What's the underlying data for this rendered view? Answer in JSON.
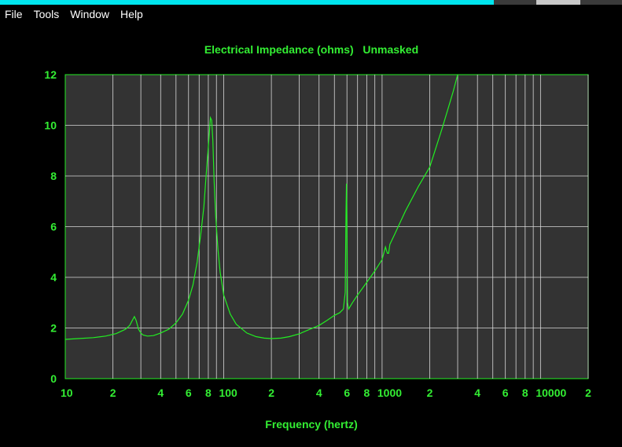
{
  "menu": {
    "items": [
      "File",
      "Tools",
      "Window",
      "Help"
    ]
  },
  "colors": {
    "background": "#000000",
    "plot_background": "#333333",
    "grid": "#d8d8d8",
    "curve": "#22ee22",
    "text": "#33ee33",
    "titlebar": "#00e5ee"
  },
  "chart_data": {
    "type": "line",
    "title": "Electrical Impedance (ohms)   Unmasked",
    "xlabel": "Frequency (hertz)",
    "ylabel": "",
    "xscale": "log",
    "xlim": [
      10,
      20000
    ],
    "ylim": [
      0,
      12
    ],
    "grid": true,
    "yticks": [
      "0",
      "2",
      "4",
      "6",
      "8",
      "10",
      "12"
    ],
    "xticks": [
      {
        "value": 10,
        "label": "10"
      },
      {
        "value": 20,
        "label": "2"
      },
      {
        "value": 40,
        "label": "4"
      },
      {
        "value": 60,
        "label": "6"
      },
      {
        "value": 80,
        "label": "8"
      },
      {
        "value": 100,
        "label": "100"
      },
      {
        "value": 200,
        "label": "2"
      },
      {
        "value": 400,
        "label": "4"
      },
      {
        "value": 600,
        "label": "6"
      },
      {
        "value": 800,
        "label": "8"
      },
      {
        "value": 1000,
        "label": "1000"
      },
      {
        "value": 2000,
        "label": "2"
      },
      {
        "value": 4000,
        "label": "4"
      },
      {
        "value": 6000,
        "label": "6"
      },
      {
        "value": 8000,
        "label": "8"
      },
      {
        "value": 10000,
        "label": "10000"
      },
      {
        "value": 20000,
        "label": "2"
      }
    ],
    "series": [
      {
        "x": [
          10,
          12,
          15,
          18,
          21,
          24,
          25.5,
          26.5,
          27.3,
          28,
          29,
          30,
          31,
          33,
          36,
          40,
          45,
          50,
          55,
          60,
          64,
          68,
          72,
          75,
          77,
          79,
          81,
          82.5,
          84,
          85.5,
          87,
          89,
          92,
          95,
          100,
          110,
          120,
          140,
          160,
          180,
          200,
          230,
          260,
          300,
          350,
          400,
          450,
          500,
          540,
          570,
          585,
          592,
          596,
          600,
          605,
          615,
          650,
          700,
          800,
          900,
          1000,
          1050,
          1080,
          1100,
          1120,
          1200,
          1400,
          1700,
          2000,
          2400,
          2800,
          3000
        ],
        "y": [
          1.55,
          1.58,
          1.62,
          1.68,
          1.78,
          1.95,
          2.1,
          2.3,
          2.45,
          2.3,
          1.95,
          1.8,
          1.72,
          1.68,
          1.7,
          1.8,
          1.95,
          2.2,
          2.55,
          3.1,
          3.7,
          4.6,
          5.8,
          6.8,
          7.8,
          8.7,
          9.6,
          10.3,
          10.2,
          9.4,
          7.8,
          6.4,
          5.1,
          4.2,
          3.3,
          2.55,
          2.15,
          1.8,
          1.66,
          1.6,
          1.58,
          1.6,
          1.66,
          1.77,
          1.95,
          2.1,
          2.3,
          2.5,
          2.6,
          2.75,
          3.4,
          6.5,
          7.7,
          6.2,
          3.0,
          2.75,
          3.0,
          3.3,
          3.8,
          4.25,
          4.7,
          5.2,
          4.95,
          4.95,
          5.3,
          5.7,
          6.6,
          7.6,
          8.35,
          9.9,
          11.3,
          12
        ]
      }
    ]
  }
}
